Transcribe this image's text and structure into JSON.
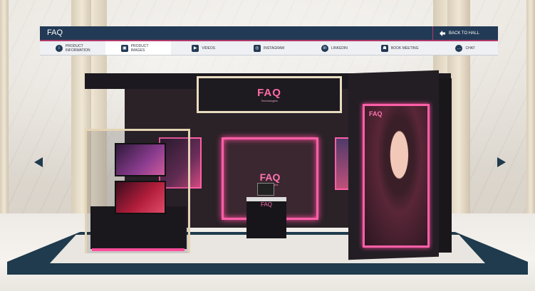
{
  "header": {
    "title": "FAQ",
    "back_label": "BACK TO HALL"
  },
  "menu": [
    {
      "label": "PRODUCT INFORMATION",
      "icon": "info-icon"
    },
    {
      "label": "PRODUCT IMAGES",
      "icon": "images-icon"
    },
    {
      "label": "VIDEOS",
      "icon": "video-icon"
    },
    {
      "label": "INSTAGRAM",
      "icon": "instagram-icon"
    },
    {
      "label": "LINKEDIN",
      "icon": "linkedin-icon"
    },
    {
      "label": "BOOK MEETING",
      "icon": "meeting-icon"
    },
    {
      "label": "CHAT",
      "icon": "chat-icon"
    }
  ],
  "booth": {
    "brand": "FAQ",
    "tagline": "Technologies",
    "counter_brand": "FAQ"
  },
  "colors": {
    "nav_bg": "#223a55",
    "accent": "#b23a6b",
    "neon": "#ff5fa8",
    "floor_band": "#1f3b4d"
  }
}
